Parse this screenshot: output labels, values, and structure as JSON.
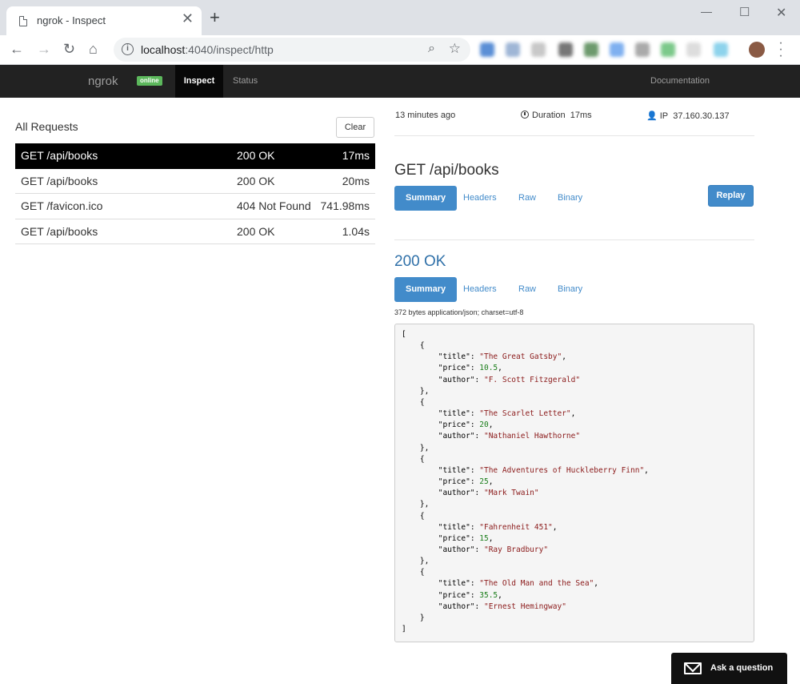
{
  "browser": {
    "tab_title": "ngrok - Inspect",
    "url_host": "localhost",
    "url_rest": ":4040/inspect/http",
    "new_tab": "+",
    "tab_close": "✕"
  },
  "navbar": {
    "brand": "ngrok",
    "badge": "online",
    "items": [
      "Inspect",
      "Status"
    ],
    "docs": "Documentation"
  },
  "requests": {
    "heading": "All Requests",
    "clear_label": "Clear",
    "rows": [
      {
        "path": "GET /api/books",
        "status": "200 OK",
        "duration": "17ms"
      },
      {
        "path": "GET /api/books",
        "status": "200 OK",
        "duration": "20ms"
      },
      {
        "path": "GET /favicon.ico",
        "status": "404 Not Found",
        "duration": "741.98ms"
      },
      {
        "path": "GET /api/books",
        "status": "200 OK",
        "duration": "1.04s"
      }
    ]
  },
  "detail": {
    "time_ago": "13 minutes ago",
    "duration_label": "Duration",
    "duration_value": "17ms",
    "ip_label": "IP",
    "ip_value": "37.160.30.137",
    "request_title": "GET /api/books",
    "request_tabs": [
      "Summary",
      "Headers",
      "Raw",
      "Binary"
    ],
    "replay_label": "Replay",
    "response_title": "200 OK",
    "response_tabs": [
      "Summary",
      "Headers",
      "Raw",
      "Binary"
    ],
    "response_info": "372 bytes application/json; charset=utf-8",
    "books": [
      {
        "title": "The Great Gatsby",
        "price": "10.5",
        "author": "F. Scott Fitzgerald"
      },
      {
        "title": "The Scarlet Letter",
        "price": "20",
        "author": "Nathaniel Hawthorne"
      },
      {
        "title": "The Adventures of Huckleberry Finn",
        "price": "25",
        "author": "Mark Twain"
      },
      {
        "title": "Fahrenheit 451",
        "price": "15",
        "author": "Ray Bradbury"
      },
      {
        "title": "The Old Man and the Sea",
        "price": "35.5",
        "author": "Ernest Hemingway"
      }
    ]
  },
  "chat": {
    "label": "Ask a question"
  },
  "colors": {
    "accent": "#428bca",
    "navbar": "#222222",
    "online": "#5cb85c"
  }
}
